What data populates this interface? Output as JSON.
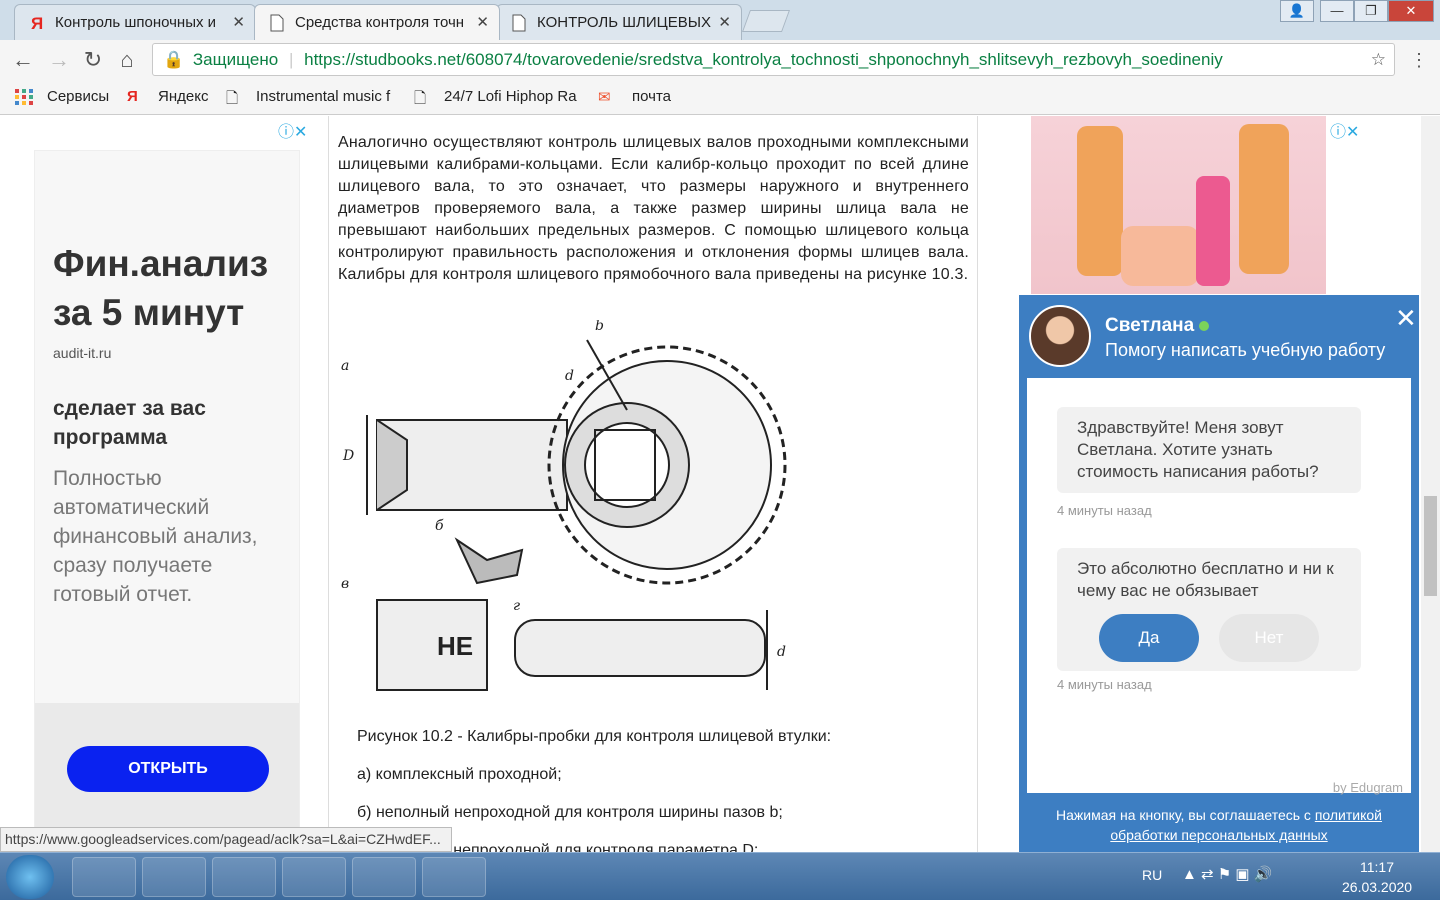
{
  "tabs": [
    {
      "title": "Контроль шпоночных и"
    },
    {
      "title": "Средства контроля точн"
    },
    {
      "title": "КОНТРОЛЬ ШЛИЦЕВЫХ"
    }
  ],
  "address": {
    "secure_label": "Защищено",
    "url": "https://studbooks.net/608074/tovarovedenie/sredstva_kontrolya_tochnosti_shponochnyh_shlitsevyh_rezbovyh_soedineniy"
  },
  "bookmarks": [
    "Сервисы",
    "Яндекс",
    "Instrumental music f",
    "24/7 Lofi Hiphop Ra",
    "почта"
  ],
  "left_ad": {
    "headline": "Фин.анализ за 5 минут",
    "domain": "audit-it.ru",
    "sub": "сделает за вас программа",
    "body": "Полностью автоматический финансовый анализ, сразу получаете готовый отчет.",
    "button": "ОТКРЫТЬ"
  },
  "article": {
    "paragraph": "Аналогично осуществляют контроль шлицевых валов проходными комплексными шлицевыми калибрами-кольцами. Если калибр-кольцо проходит по всей длине шлицевого вала, то это означает, что размеры наружного и внутреннего диаметров проверяемого вала, а также размер ширины шлица вала не превышают наибольших предельных размеров. С помощью шлицевого кольца контролируют правильность расположения и отклонения формы шлицев вала. Калибры для контроля шлицевого прямобочного вала приведены на рисунке 10.3.",
    "figure_labels": {
      "a": "а",
      "b": "б",
      "v": "в",
      "g": "г",
      "D": "D",
      "d": "d",
      "bdim": "b",
      "ne": "НЕ"
    },
    "caption": "Рисунок 10.2 - Калибры-пробки для контроля шлицевой втулки:",
    "items": [
      "а) комплексный проходной;",
      "б) неполный непроходной для контроля ширины пазов b;",
      "в) неполный непроходной для контроля параметра D;"
    ]
  },
  "chat": {
    "name": "Светлана",
    "subtitle": "Помогу написать учебную работу",
    "msg1": "Здравствуйте! Меня зовут Светлана. Хотите узнать стоимость написания работы?",
    "time1": "4 минуты назад",
    "msg2": "Это абсолютно бесплатно и ни к чему вас не обязывает",
    "yes": "Да",
    "no": "Нет",
    "time2": "4 минуты назад",
    "brand": "by Edugram",
    "consent_prefix": "Нажимая на кнопку, вы соглашаетесь с ",
    "consent_link": "политикой обработки персональных данных"
  },
  "status_url": "https://www.googleadservices.com/pagead/aclk?sa=L&ai=CZHwdEF...",
  "system_tray": {
    "lang": "RU",
    "time": "11:17",
    "date": "26.03.2020"
  }
}
